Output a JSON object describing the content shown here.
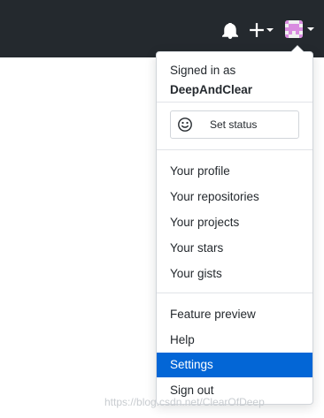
{
  "header_bar": {
    "icons": [
      "bell-icon",
      "plus-icon",
      "avatar-icon"
    ],
    "background": "#24292e"
  },
  "menu": {
    "signed_in_label": "Signed in as",
    "username": "DeepAndClear",
    "set_status_label": "Set status",
    "profile_items": [
      {
        "label": "Your profile"
      },
      {
        "label": "Your repositories"
      },
      {
        "label": "Your projects"
      },
      {
        "label": "Your stars"
      },
      {
        "label": "Your gists"
      }
    ],
    "account_items": [
      {
        "label": "Feature preview"
      },
      {
        "label": "Help"
      },
      {
        "label": "Settings",
        "active": true
      },
      {
        "label": "Sign out"
      }
    ],
    "active_color": "#0366d6"
  },
  "watermark": "https://blog.csdn.net/ClearOfDeep"
}
